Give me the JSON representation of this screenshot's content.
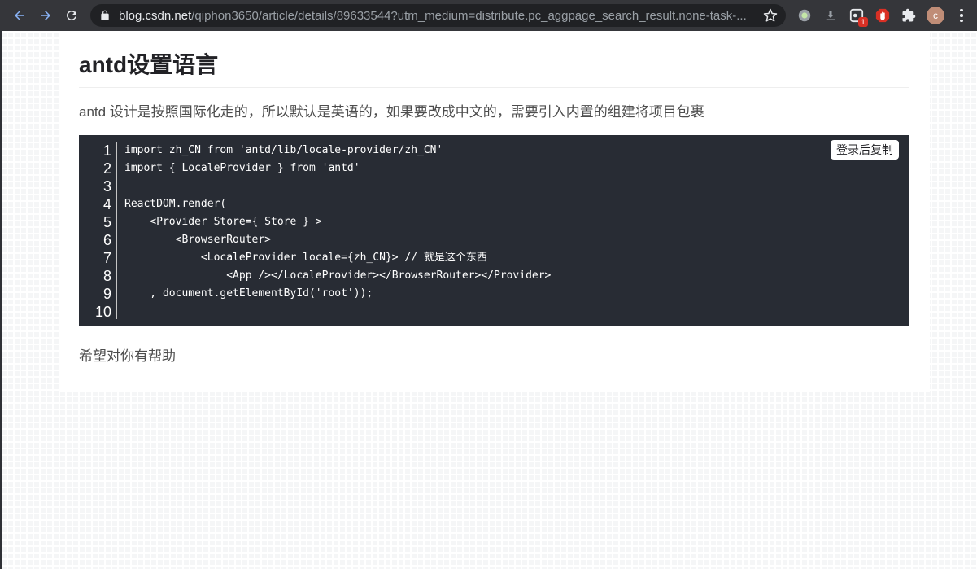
{
  "browser": {
    "url_host": "blog.csdn.net",
    "url_path": "/qiphon3650/article/details/89633544?utm_medium=distribute.pc_aggpage_search_result.none-task-...",
    "extension_badge": "1",
    "profile_initial": "c",
    "icons": [
      "back-icon",
      "forward-icon",
      "reload-icon",
      "lock-icon",
      "star-icon",
      "extension-circle-icon",
      "download-icon",
      "extension-badge-icon",
      "adblock-icon",
      "puzzle-icon",
      "menu-icon"
    ]
  },
  "article": {
    "title": "antd设置语言",
    "intro": "antd 设计是按照国际化走的，所以默认是英语的，如果要改成中文的，需要引入内置的组建将项目包裹",
    "code": {
      "copy_label": "登录后复制",
      "line_numbers": [
        "1",
        "2",
        "3",
        "4",
        "5",
        "6",
        "7",
        "8",
        "9",
        "10"
      ],
      "lines": [
        "import zh_CN from 'antd/lib/locale-provider/zh_CN'",
        "import { LocaleProvider } from 'antd'",
        "",
        "ReactDOM.render(",
        "    <Provider Store={ Store } >",
        "        <BrowserRouter>",
        "            <LocaleProvider locale={zh_CN}> // 就是这个东西",
        "                <App /></LocaleProvider></BrowserRouter></Provider>",
        "    , document.getElementById('root'));",
        ""
      ]
    },
    "closing": "希望对你有帮助"
  },
  "colors": {
    "toolbar_bg": "#35363a",
    "omnibox_bg": "#202124",
    "code_bg": "#282c34",
    "page_bg": "#f5f6f7"
  }
}
